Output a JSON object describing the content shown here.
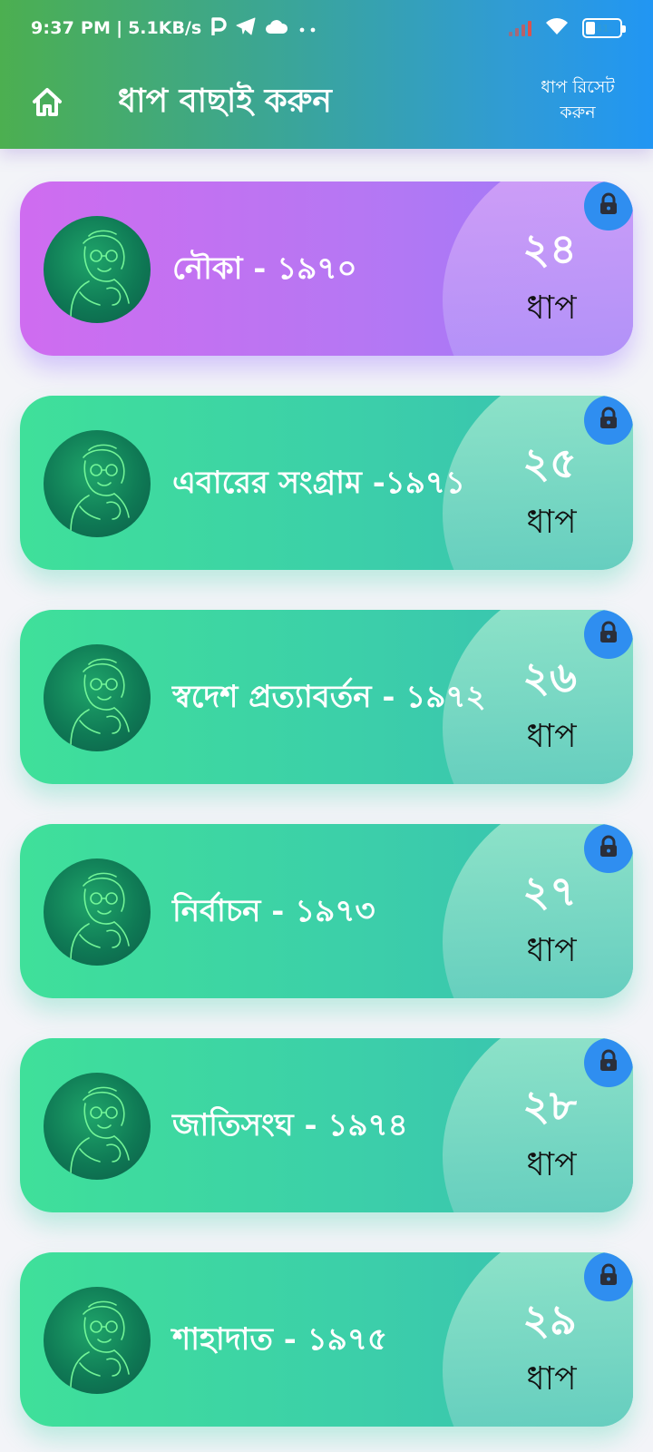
{
  "status_bar": {
    "time": "9:37 PM",
    "separator": "|",
    "net_speed": "5.1KB/s",
    "icons": [
      "p-app-icon",
      "telegram-icon",
      "cloud-icon",
      "more-dots-icon",
      "signal-icon",
      "wifi-icon",
      "battery-icon"
    ],
    "battery_level": "41"
  },
  "app_bar": {
    "home_icon": "home-icon",
    "title": "ধাপ বাছাই করুন",
    "reset_line1": "ধাপ রিসেট",
    "reset_line2": "করুন"
  },
  "colors": {
    "app_bar_start": "#4caf50",
    "app_bar_end": "#2196f3",
    "card_first": "#b677f3",
    "card_other": "#3ccfa9",
    "lock_badge": "#2f8ef0"
  },
  "levels": [
    {
      "title": "নৌকা - ১৯৭০",
      "number": "২৪",
      "word": "ধাপ",
      "locked": true,
      "style": "purple"
    },
    {
      "title": "এবারের সংগ্রাম -১৯৭১",
      "number": "২৫",
      "word": "ধাপ",
      "locked": true,
      "style": "green"
    },
    {
      "title": "স্বদেশ প্রত্যাবর্তন - ১৯৭২",
      "number": "২৬",
      "word": "ধাপ",
      "locked": true,
      "style": "green"
    },
    {
      "title": "নির্বাচন - ১৯৭৩",
      "number": "২৭",
      "word": "ধাপ",
      "locked": true,
      "style": "green"
    },
    {
      "title": "জাতিসংঘ - ১৯৭৪",
      "number": "২৮",
      "word": "ধাপ",
      "locked": true,
      "style": "green"
    },
    {
      "title": "শাহাদাত - ১৯৭৫",
      "number": "২৯",
      "word": "ধাপ",
      "locked": true,
      "style": "green"
    }
  ]
}
